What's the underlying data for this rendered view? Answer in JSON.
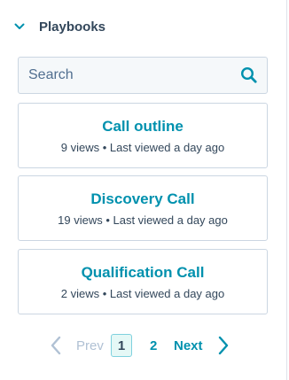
{
  "section": {
    "title": "Playbooks",
    "toggle_icon": "chevron-down-icon"
  },
  "search": {
    "placeholder": "Search",
    "value": "",
    "icon": "search-icon"
  },
  "playbooks": [
    {
      "name": "Call outline",
      "meta": "9 views • Last viewed a day ago"
    },
    {
      "name": "Discovery Call",
      "meta": "19 views • Last viewed a day ago"
    },
    {
      "name": "Qualification Call",
      "meta": "2 views • Last viewed a day ago"
    }
  ],
  "pagination": {
    "prev_label": "Prev",
    "current_page": "1",
    "next_page": "2",
    "next_label": "Next"
  },
  "colors": {
    "accent": "#0091ae",
    "text": "#33475b",
    "disabled": "#b0c1d4",
    "border": "#cbd6e2"
  }
}
